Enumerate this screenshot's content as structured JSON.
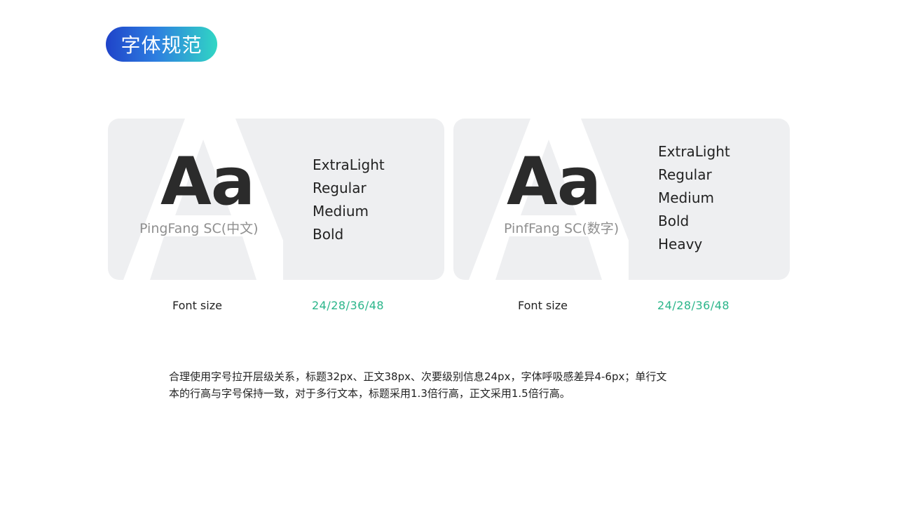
{
  "page": {
    "title": "字体规范"
  },
  "cards": [
    {
      "sample": "Aa",
      "font_name": "PingFang SC(中文)",
      "weights": [
        "ExtraLight",
        "Regular",
        "Medium",
        "Bold"
      ],
      "size_label": "Font size",
      "size_value": "24/28/36/48"
    },
    {
      "sample": "Aa",
      "font_name": "PinfFang SC(数字)",
      "weights": [
        "ExtraLight",
        "Regular",
        "Medium",
        "Bold",
        "Heavy"
      ],
      "size_label": "Font size",
      "size_value": "24/28/36/48"
    }
  ],
  "description": {
    "line1": "合理使用字号拉开层级关系，标题32px、正文38px、次要级别信息24px，字体呼吸感差异4-6px；单行文",
    "line2": "本的行高与字号保持一致，对于多行文本，标题采用1.3倍行高，正文采用1.5倍行高。"
  },
  "colors": {
    "accent_green": "#2bb58a",
    "pill_start": "#1f43c9",
    "pill_end": "#31d6c4",
    "card_bg": "#eeeff1"
  }
}
